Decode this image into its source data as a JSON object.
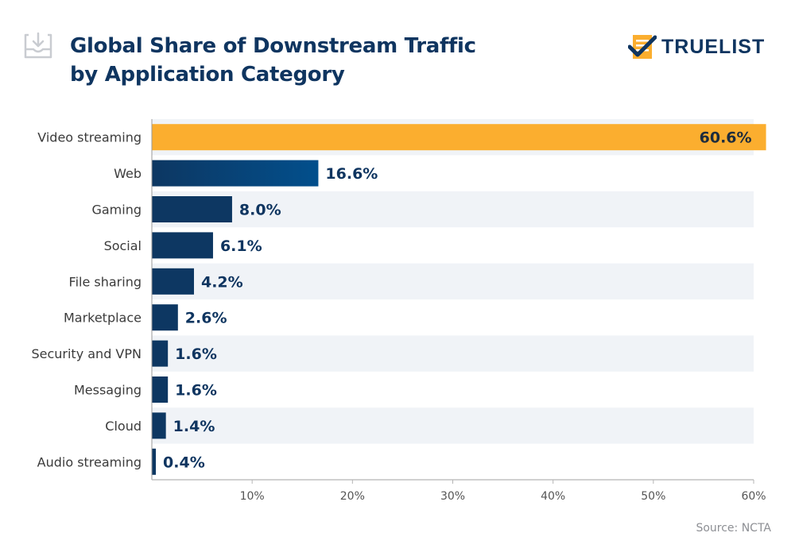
{
  "header": {
    "title_line1": "Global Share of Downstream Traffic",
    "title_line2": "by Application Category",
    "icon": "download-icon",
    "brand": "TRUELIST",
    "brand_icon": "checklist-icon"
  },
  "colors": {
    "highlight": "#fbae2f",
    "bar": "#0d3762",
    "bar_gradient_end": "#024f8c",
    "band": "#f0f3f7",
    "title": "#0f3560",
    "label": "#3b3b3b",
    "axis": "#b5b5b5"
  },
  "chart_data": {
    "type": "bar",
    "orientation": "horizontal",
    "title": "Global Share of Downstream Traffic by Application Category",
    "categories": [
      "Video streaming",
      "Web",
      "Gaming",
      "Social",
      "File sharing",
      "Marketplace",
      "Security and VPN",
      "Messaging",
      "Cloud",
      "Audio streaming"
    ],
    "values": [
      60.6,
      16.6,
      8.0,
      6.1,
      4.2,
      2.6,
      1.6,
      1.6,
      1.4,
      0.4
    ],
    "data_labels": [
      "60.6%",
      "16.6%",
      "8.0%",
      "6.1%",
      "4.2%",
      "2.6%",
      "1.6%",
      "1.6%",
      "1.4%",
      "0.4%"
    ],
    "highlight_index": 0,
    "xlabel": "",
    "ylabel": "",
    "xlim": [
      0,
      60
    ],
    "xticks": [
      10,
      20,
      30,
      40,
      50,
      60
    ],
    "xtick_labels": [
      "10%",
      "20%",
      "30%",
      "40%",
      "50%",
      "60%"
    ],
    "grid": false,
    "legend": "none"
  },
  "footer": {
    "source": "Source: NCTA"
  }
}
